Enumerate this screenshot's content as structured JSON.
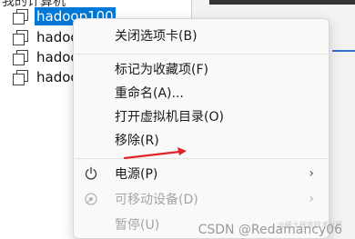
{
  "tree": {
    "header": "我的计算机",
    "items": [
      {
        "label": "hadoop100",
        "selected": true
      },
      {
        "label": "hadoop"
      },
      {
        "label": "hadoop"
      },
      {
        "label": "hadoop"
      }
    ]
  },
  "menu": {
    "close_tab": "关闭选项卡(B)",
    "favorite": "标记为收藏项(F)",
    "rename": "重命名(A)...",
    "open_dir": "打开虚拟机目录(O)",
    "remove": "移除(R)",
    "power": "电源(P)",
    "removable_devices": "可移动设备(D)",
    "pause": "暂停(U)",
    "submenu_arrow": "›"
  },
  "watermark": {
    "text": "CSDN @Redamancy06",
    "faint": "@稀土掘金技术社区"
  },
  "colors": {
    "selection": "#0078d7",
    "annotation_arrow": "#e0242a",
    "disabled_text": "#a5a5a5"
  },
  "icons": {
    "vm": "vm-icon",
    "power": "power-icon",
    "devices": "removable-device-icon"
  }
}
